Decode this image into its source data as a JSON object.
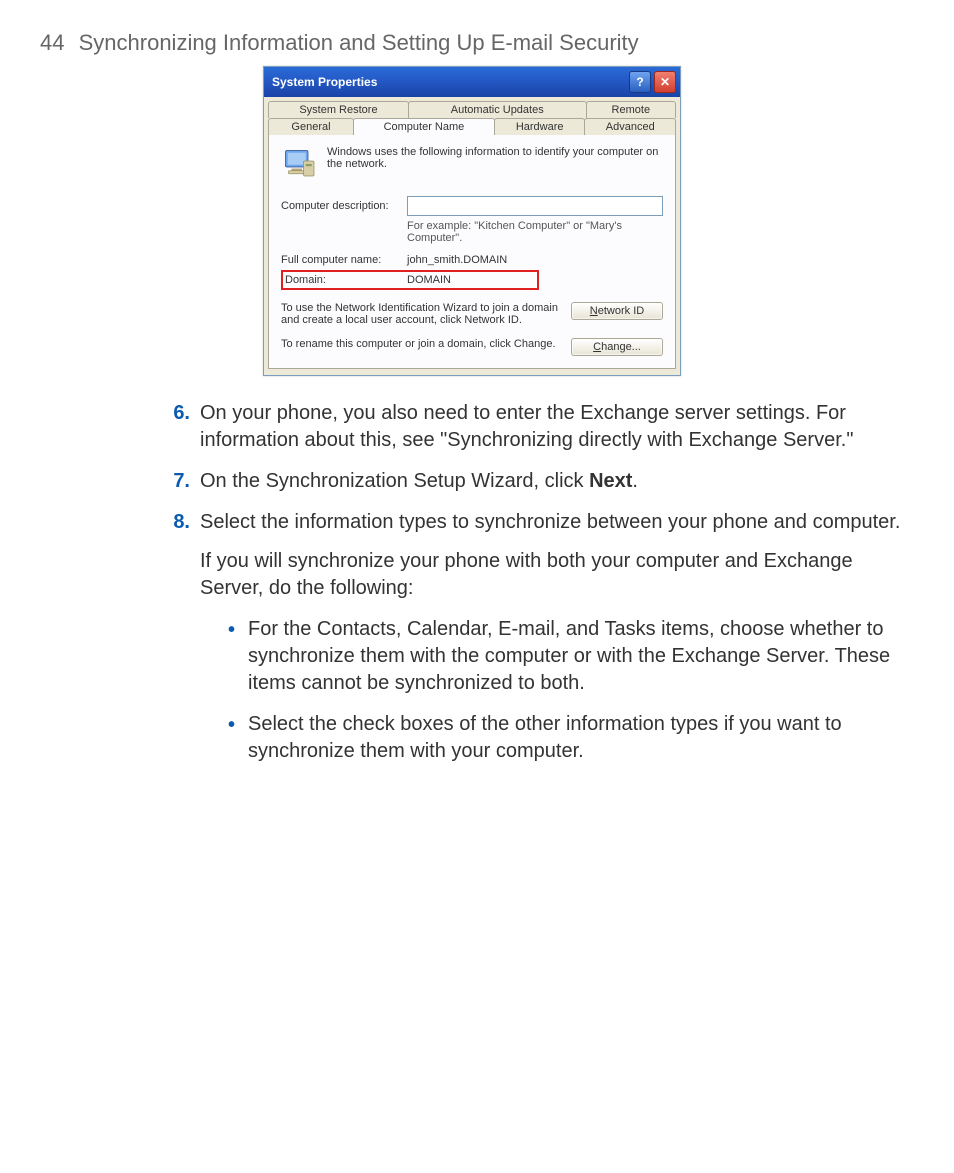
{
  "page": {
    "number": "44",
    "title": "Synchronizing Information and Setting Up E-mail Security"
  },
  "dialog": {
    "title": "System Properties",
    "help_glyph": "?",
    "close_glyph": "✕",
    "tabs_row1": [
      "System Restore",
      "Automatic Updates",
      "Remote"
    ],
    "tabs_row2": [
      "General",
      "Computer Name",
      "Hardware",
      "Advanced"
    ],
    "intro": "Windows uses the following information to identify your computer on the network.",
    "desc_label": "Computer description:",
    "desc_hint": "For example: \"Kitchen Computer\" or \"Mary's Computer\".",
    "full_name_label": "Full computer name:",
    "full_name_value": "john_smith.DOMAIN",
    "domain_label": "Domain:",
    "domain_value": "DOMAIN",
    "wizard_text": "To use the Network Identification Wizard to join a domain and create a local user account, click Network ID.",
    "network_id_btn_u": "N",
    "network_id_btn_rest": "etwork ID",
    "rename_text": "To rename this computer or join a domain, click Change.",
    "change_btn_u": "C",
    "change_btn_rest": "hange..."
  },
  "steps": {
    "s6_num": "6.",
    "s6_text": "On your phone, you also need to enter the Exchange server settings. For information about this, see \"Synchronizing directly with Exchange Server.\"",
    "s7_num": "7.",
    "s7_pre": "On the Synchronization Setup Wizard, click ",
    "s7_bold": "Next",
    "s7_post": ".",
    "s8_num": "8.",
    "s8_text": "Select the information types to synchronize between your phone and computer.",
    "s8_sub": "If you will synchronize your phone with both your computer and Exchange Server, do the following:",
    "b1": "For the Contacts, Calendar, E-mail, and Tasks items, choose whether to synchronize them with the computer or with the Exchange Server. These items cannot be synchronized to both.",
    "b2": "Select the check boxes of the other information types if you want to synchronize them with your computer."
  }
}
